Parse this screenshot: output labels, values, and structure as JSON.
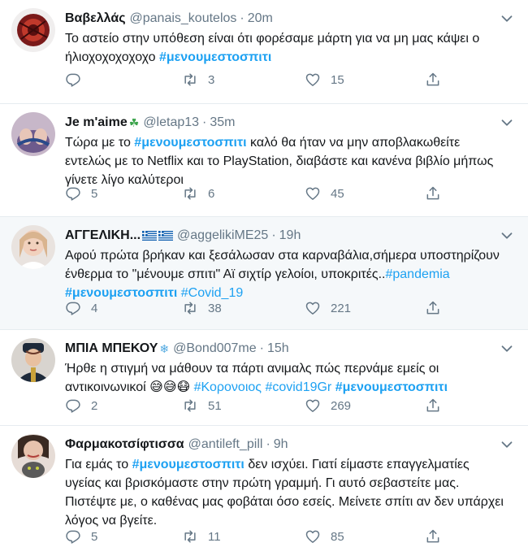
{
  "tweets": [
    {
      "name": "Βαβελλάς",
      "badge": "",
      "handle": "@panais_koutelos",
      "time": "20m",
      "text_parts": [
        {
          "t": "Το αστείο στην υπόθεση είναι ότι φορέσαμε μάρτη για να μη μας κάψει ο ήλιοχοχοχοχοχο ",
          "h": false
        },
        {
          "t": "#μενουμεστοσπιτι",
          "h": true,
          "bold": true
        }
      ],
      "replies": "",
      "retweets": "3",
      "likes": "15"
    },
    {
      "name": "Je m'aime",
      "badge": "☘",
      "handle": "@letap13",
      "time": "35m",
      "text_parts": [
        {
          "t": "Τώρα με το ",
          "h": false
        },
        {
          "t": "#μενουμεστοσπιτι",
          "h": true,
          "bold": true
        },
        {
          "t": " καλό θα ήταν να μην αποβλακωθείτε εντελώς με το Netflix και το PlayStation, διαβάστε και κανένα βιβλίο μήπως γίνετε λίγο καλύτεροι",
          "h": false
        }
      ],
      "replies": "5",
      "retweets": "6",
      "likes": "45"
    },
    {
      "name": "ΑΓΓΕΛΙΚΗ...",
      "badge": "",
      "handle": "@aggelikiME25",
      "time": "19h",
      "text_parts": [
        {
          "t": "Αφού πρώτα βρήκαν και ξεσάλωσαν στα καρναβάλια,σήμερα υποστηρίζουν ένθερμα το \"μένουμε σπιτι\" Αϊ σιχτίρ γελοίοι, υποκριτές..",
          "h": false
        },
        {
          "t": "#pandemia",
          "h": true,
          "bold": false
        },
        {
          "t": " ",
          "h": false
        },
        {
          "t": "#μενουμεστοσπιτι",
          "h": true,
          "bold": true
        },
        {
          "t": " ",
          "h": false
        },
        {
          "t": "#Covid_19",
          "h": true,
          "bold": false
        }
      ],
      "replies": "4",
      "retweets": "38",
      "likes": "221"
    },
    {
      "name": "ΜΠΙΑ ΜΠΕΚΟΥ",
      "badge": "❄",
      "handle": "@Bond007me",
      "time": "15h",
      "text_parts": [
        {
          "t": "Ήρθε η στιγμή να μάθουν τα πάρτι ανιμαλς πώς περνάμε εμείς οι αντικοινωνικοί ",
          "h": false
        },
        {
          "t": "😅😅😷",
          "h": false,
          "emoji": true
        },
        {
          "t": " ",
          "h": false
        },
        {
          "t": "#Κορονοιος",
          "h": true,
          "bold": false
        },
        {
          "t": " ",
          "h": false
        },
        {
          "t": "#covid19Gr",
          "h": true,
          "bold": false
        },
        {
          "t": " ",
          "h": false
        },
        {
          "t": "#μενουμεστοσπιτι",
          "h": true,
          "bold": true
        }
      ],
      "replies": "2",
      "retweets": "51",
      "likes": "269"
    },
    {
      "name": "Φαρμακοτσίφτισσα",
      "badge": "",
      "handle": "@antileft_pill",
      "time": "9h",
      "text_parts": [
        {
          "t": "Για εμάς το ",
          "h": false
        },
        {
          "t": "#μενουμεστοσπιτι",
          "h": true,
          "bold": true
        },
        {
          "t": " δεν ισχύει. Γιατί είμαστε επαγγελματίες υγείας και βρισκόμαστε στην πρώτη γραμμή. Γι αυτό σεβαστείτε μας. Πιστέψτε με, ο καθένας μας φοβάται όσο εσείς. Μείνετε σπίτι αν δεν υπάρχει λόγος να βγείτε.",
          "h": false
        }
      ],
      "replies": "5",
      "retweets": "11",
      "likes": "85"
    }
  ],
  "icons": {
    "reply": "reply-icon",
    "retweet": "retweet-icon",
    "like": "heart-icon",
    "share": "share-icon",
    "more": "chevron-down-icon"
  },
  "colors": {
    "hashtag": "#1da1f2",
    "secondary": "#657786",
    "highlight_bg": "#f5f8fa",
    "divider": "#e6ecf0"
  }
}
